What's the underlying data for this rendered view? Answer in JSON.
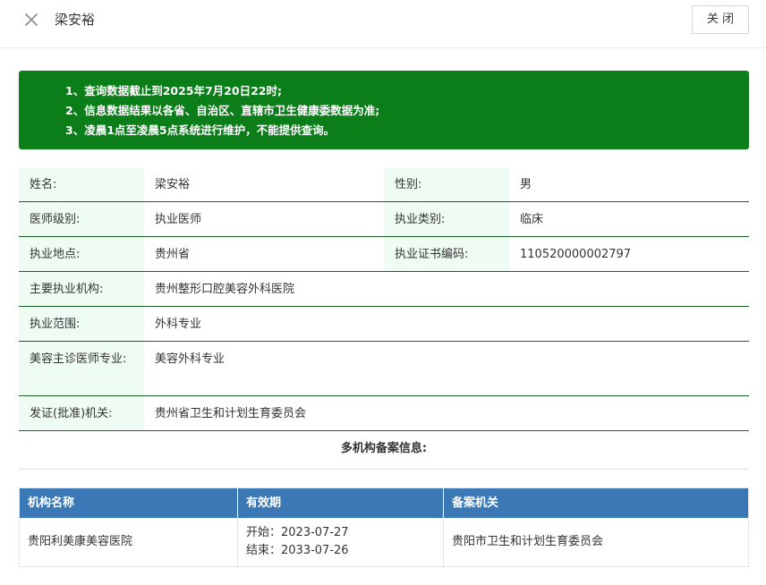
{
  "header": {
    "title": "梁安裕",
    "close_label": "关闭"
  },
  "notice": {
    "lines": [
      "1、查询数据截止到2025年7月20日22时;",
      "2、信息数据结果以各省、自治区、直辖市卫生健康委数据为准;",
      "3、凌晨1点至凌晨5点系统进行维护，不能提供查询。"
    ]
  },
  "info": {
    "name_label": "姓名:",
    "name_value": "梁安裕",
    "gender_label": "性别:",
    "gender_value": "男",
    "level_label": "医师级别:",
    "level_value": "执业医师",
    "category_label": "执业类别:",
    "category_value": "临床",
    "location_label": "执业地点:",
    "location_value": "贵州省",
    "cert_label": "执业证书编码:",
    "cert_value": "110520000002797",
    "org_label": "主要执业机构:",
    "org_value": "贵州整形口腔美容外科医院",
    "scope_label": "执业范围:",
    "scope_value": "外科专业",
    "cosmetic_label": "美容主诊医师专业:",
    "cosmetic_value": "美容外科专业",
    "issuer_label": "发证(批准)机关:",
    "issuer_value": "贵州省卫生和计划生育委员会"
  },
  "multi": {
    "title": "多机构备案信息:",
    "columns": [
      "机构名称",
      "有效期",
      "备案机关"
    ],
    "rows": [
      {
        "org": "贵阳利美康美容医院",
        "start": "开始：2023-07-27",
        "end": "结束：2033-07-26",
        "authority": "贵阳市卫生和计划生育委员会"
      }
    ]
  },
  "colors": {
    "notice_bg": "#0b7e1a",
    "label_bg": "#effcf3",
    "table_header_bg": "#3a79b6"
  }
}
